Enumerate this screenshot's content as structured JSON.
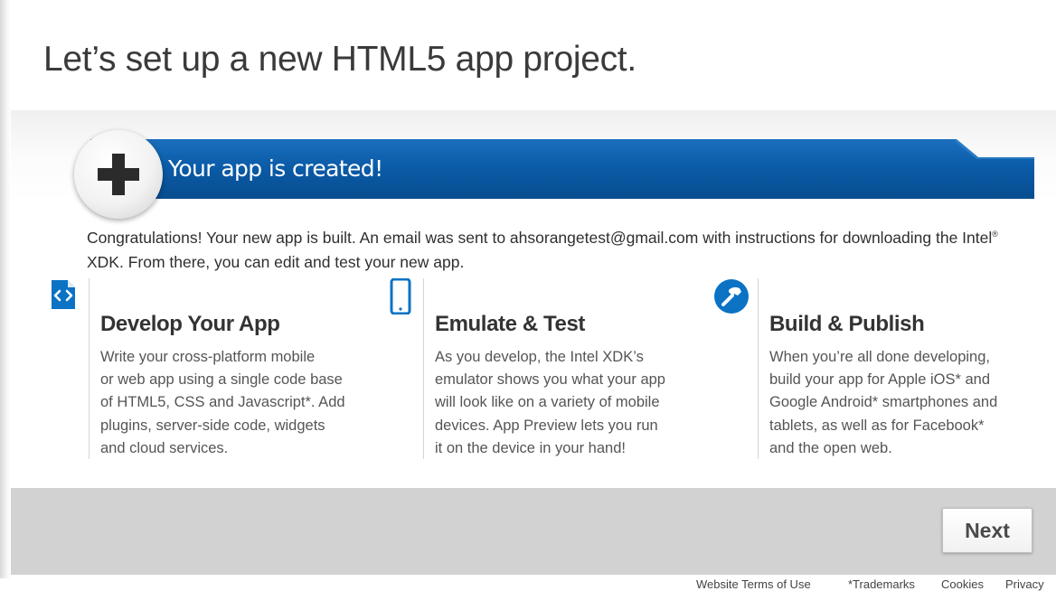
{
  "header": {
    "title": "Let’s set up a new HTML5 app project."
  },
  "banner": {
    "text": "Your app is created!",
    "icon": "plus-icon"
  },
  "message": {
    "line1": "Congratulations! Your new app is built. An email was sent to ahsorangetest@gmail.com with instructions for downloading the Intel",
    "sup": "®",
    "line2": "XDK. From there, you can edit and test your new app."
  },
  "features": [
    {
      "icon": "code-icon",
      "title": "Develop Your App",
      "body": "Write your cross-platform mobile\nor web app using a single code base\nof HTML5, CSS and Javascript*. Add\nplugins, server-side code, widgets\nand cloud services."
    },
    {
      "icon": "phone-icon",
      "title": "Emulate & Test",
      "body": "As you develop, the Intel XDK’s\nemulator shows you what your app\nwill look like on a variety of mobile\ndevices. App Preview lets you run\nit on the device in your hand!"
    },
    {
      "icon": "hammer-icon",
      "title": "Build & Publish",
      "body": "When you’re all done developing,\nbuild your app for Apple iOS* and\nGoogle Android* smartphones and\ntablets, as well as for Facebook*\nand the open web."
    }
  ],
  "actions": {
    "next_label": "Next"
  },
  "footer": {
    "links": [
      "Website Terms of Use",
      "*Trademarks",
      "Cookies",
      "Privacy"
    ]
  },
  "colors": {
    "banner_blue": "#0a5ba6",
    "icon_blue": "#0b72c4",
    "footer_gray": "#d2d2d2"
  }
}
